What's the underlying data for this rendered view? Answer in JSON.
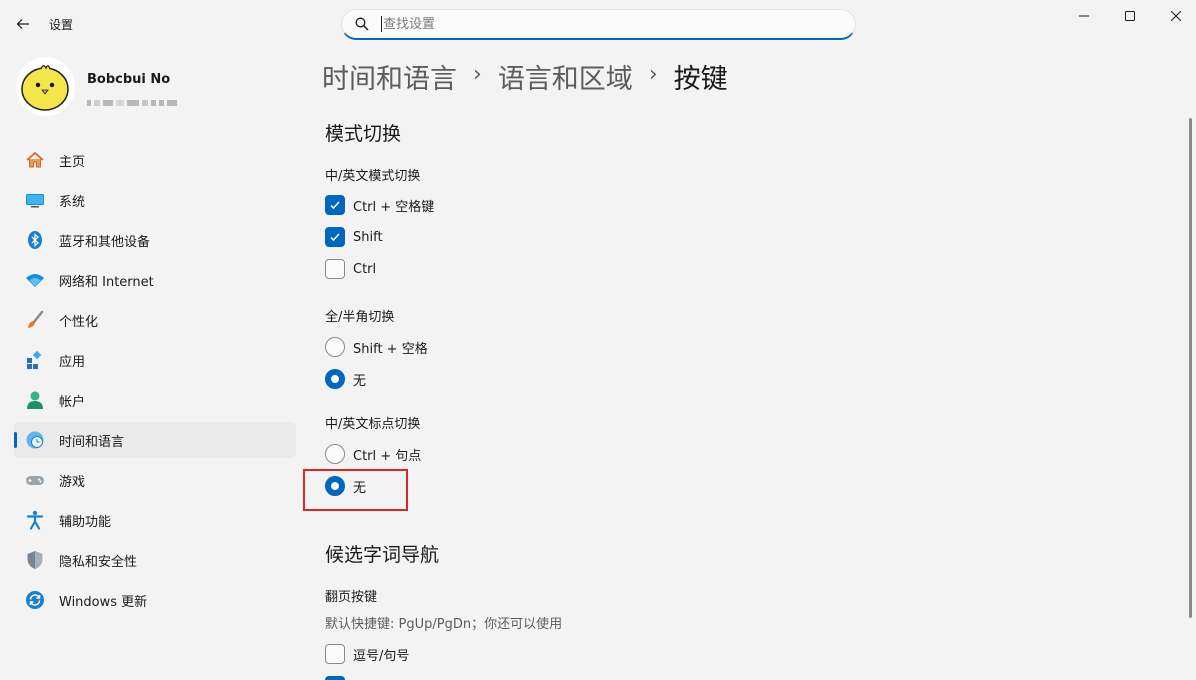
{
  "window": {
    "title": "设置",
    "search_placeholder": "查找设置"
  },
  "profile": {
    "name": "Bobcbui No"
  },
  "nav": [
    {
      "label": "主页",
      "icon": "home-icon"
    },
    {
      "label": "系统",
      "icon": "system-icon"
    },
    {
      "label": "蓝牙和其他设备",
      "icon": "bluetooth-icon"
    },
    {
      "label": "网络和 Internet",
      "icon": "wifi-icon"
    },
    {
      "label": "个性化",
      "icon": "brush-icon"
    },
    {
      "label": "应用",
      "icon": "apps-icon"
    },
    {
      "label": "帐户",
      "icon": "account-icon"
    },
    {
      "label": "时间和语言",
      "icon": "time-language-icon",
      "active": true
    },
    {
      "label": "游戏",
      "icon": "gaming-icon"
    },
    {
      "label": "辅助功能",
      "icon": "accessibility-icon"
    },
    {
      "label": "隐私和安全性",
      "icon": "shield-icon"
    },
    {
      "label": "Windows 更新",
      "icon": "update-icon"
    }
  ],
  "breadcrumb": {
    "items": [
      "时间和语言",
      "语言和区域"
    ],
    "current": "按键"
  },
  "sections": {
    "mode_switch": {
      "title": "模式切换",
      "cn_en": {
        "label": "中/英文模式切换",
        "options": [
          {
            "label": "Ctrl + 空格键",
            "checked": true
          },
          {
            "label": "Shift",
            "checked": true
          },
          {
            "label": "Ctrl",
            "checked": false
          }
        ]
      },
      "full_half": {
        "label": "全/半角切换",
        "options": [
          {
            "label": "Shift + 空格",
            "selected": false
          },
          {
            "label": "无",
            "selected": true
          }
        ]
      },
      "punct": {
        "label": "中/英文标点切换",
        "options": [
          {
            "label": "Ctrl + 句点",
            "selected": false
          },
          {
            "label": "无",
            "selected": true
          }
        ]
      }
    },
    "candidate_nav": {
      "title": "候选字词导航",
      "paging_label": "翻页按键",
      "paging_hint": "默认快捷键: PgUp/PgDn；你还可以使用",
      "options": [
        {
          "label": "逗号/句号",
          "checked": false
        }
      ]
    }
  },
  "colors": {
    "accent": "#0067c0",
    "highlight_box": "#d72727",
    "background": "#f3f3f3"
  }
}
